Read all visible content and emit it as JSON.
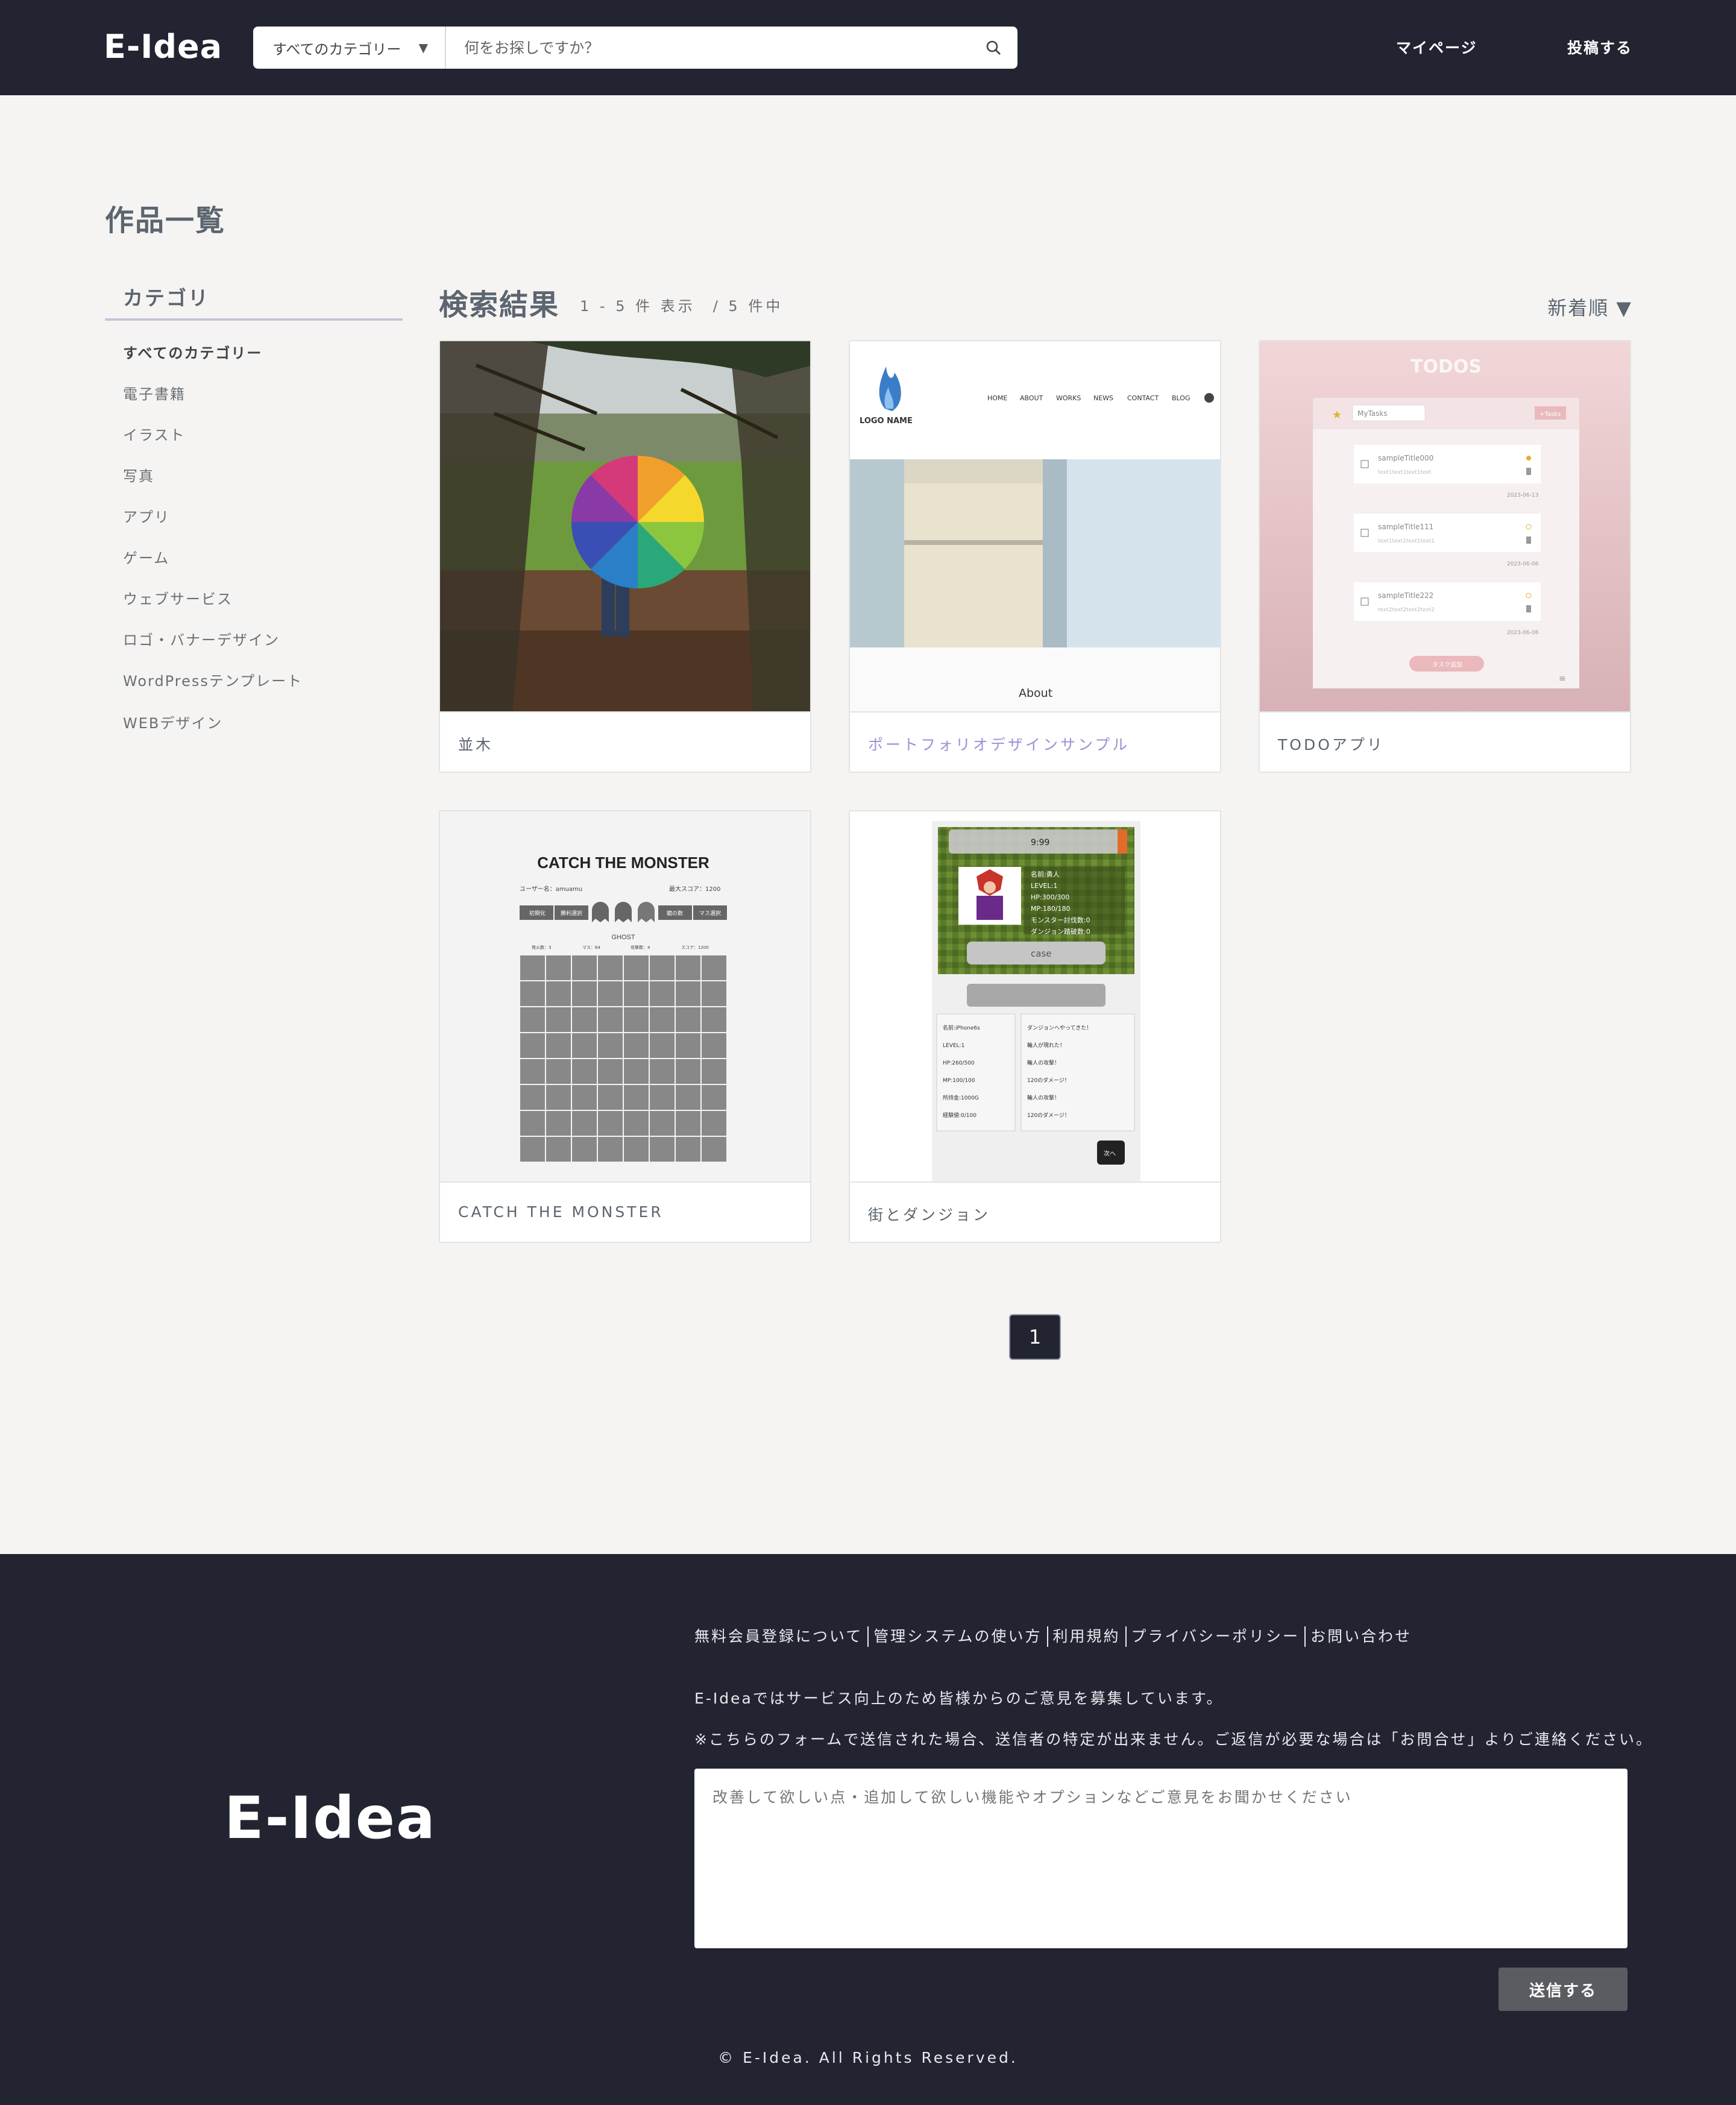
{
  "header": {
    "logo": "E-Idea",
    "search_category": "すべてのカテゴリー",
    "search_placeholder": "何をお探しですか？",
    "nav_mypage": "マイページ",
    "nav_post": "投稿する"
  },
  "page": {
    "title": "作品一覧"
  },
  "sidebar": {
    "title": "カテゴリ",
    "items": [
      {
        "label": "すべてのカテゴリー"
      },
      {
        "label": "電子書籍"
      },
      {
        "label": "イラスト"
      },
      {
        "label": "写真"
      },
      {
        "label": "アプリ"
      },
      {
        "label": "ゲーム"
      },
      {
        "label": "ウェブサービス"
      },
      {
        "label": "ロゴ・バナーデザイン"
      },
      {
        "label": "WordPressテンプレート"
      },
      {
        "label": "WEBデザイン"
      }
    ]
  },
  "results": {
    "title": "検索結果",
    "count": "1 - 5 件 表示　/ 5 件中",
    "sort": "新着順 ▼",
    "cards": [
      {
        "title": "並木"
      },
      {
        "title": "ポートフォリオデザインサンプル"
      },
      {
        "title": "TODOアプリ"
      },
      {
        "title": "CATCH THE MONSTER"
      },
      {
        "title": "街とダンジョン"
      }
    ]
  },
  "thumbs": {
    "portfolio": {
      "logo": "LOGO NAME",
      "nav": [
        "HOME",
        "ABOUT",
        "WORKS",
        "NEWS",
        "CONTACT",
        "BLOG"
      ],
      "about": "About"
    },
    "todo": {
      "heading": "TODOS",
      "list": "MyTasks",
      "add": "+Tasks",
      "tasks": [
        {
          "title": "sampleTitle000",
          "text": "text1text1text1text",
          "date": "2023-06-13"
        },
        {
          "title": "sampleTitle111",
          "text": "text1text1text1text1",
          "date": "2023-06-06"
        },
        {
          "title": "sampleTitle222",
          "text": "text2text2text2text2",
          "date": "2023-06-08"
        }
      ],
      "button": "タスク追加"
    },
    "monster": {
      "heading": "CATCH THE MONSTER",
      "user": "ユーザー名：amuamu",
      "best": "最大スコア：1200",
      "btns": [
        "初期化",
        "勝利選択",
        "鏡の数",
        "マス選択"
      ],
      "ghost": "GHOST",
      "stats": [
        "発火数：3",
        "マス：64",
        "攻撃数：4",
        "スコア：1200"
      ]
    },
    "dungeon": {
      "time": "9:99",
      "status": [
        "名前:勇人",
        "LEVEL:1",
        "HP:300/300",
        "MP:180/180",
        "モンスター討伐数:0",
        "ダンジョン踏破数:0"
      ],
      "case": "case",
      "left": [
        "名前:iPhone6s",
        "LEVEL:1",
        "HP:260/500",
        "MP:100/100",
        "所持金:1000G",
        "経験値:0/100"
      ],
      "right": [
        "ダンジョンへやってきた！",
        "輪人が現れた！",
        "輪人の攻撃！",
        "120のダメージ！",
        "輪人の攻撃！",
        "120のダメージ！"
      ],
      "next": "次へ"
    }
  },
  "pagination": {
    "current": "1"
  },
  "footer": {
    "logo": "E-Idea",
    "links": [
      "無料会員登録について",
      "管理システムの使い方",
      "利用規約",
      "プライバシーポリシー",
      "お問い合わせ"
    ],
    "text1": "E-Ideaではサービス向上のため皆様からのご意見を募集しています。",
    "text2": "※こちらのフォームで送信された場合、送信者の特定が出来ません。ご返信が必要な場合は「お問合せ」よりご連絡ください。",
    "textarea_placeholder": "改善して欲しい点・追加して欲しい機能やオプションなどご意見をお聞かせください",
    "submit": "送信する",
    "copyright": "© E-Idea. All Rights Reserved."
  }
}
